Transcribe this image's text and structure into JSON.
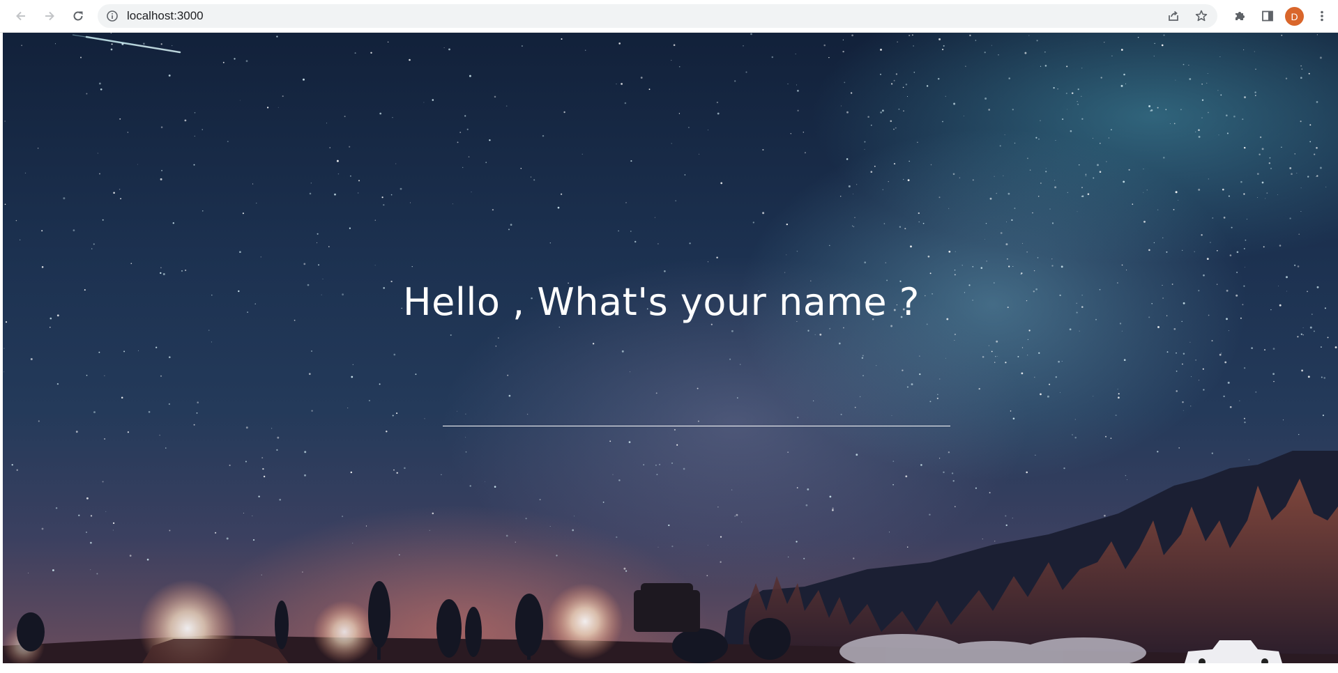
{
  "browser": {
    "url": "localhost:3000",
    "profile_initial": "D",
    "profile_color": "#d9662b",
    "icons": {
      "back": "arrow-left-icon",
      "forward": "arrow-right-icon",
      "reload": "reload-icon",
      "site_info": "info-icon",
      "share": "share-icon",
      "bookmark": "star-icon",
      "extensions": "puzzle-icon",
      "side_panel": "side-panel-icon",
      "menu": "kebab-menu-icon"
    }
  },
  "page": {
    "heading": "Hello , What's your name ?",
    "name_input_value": "",
    "accent_color": "#ffffff"
  }
}
